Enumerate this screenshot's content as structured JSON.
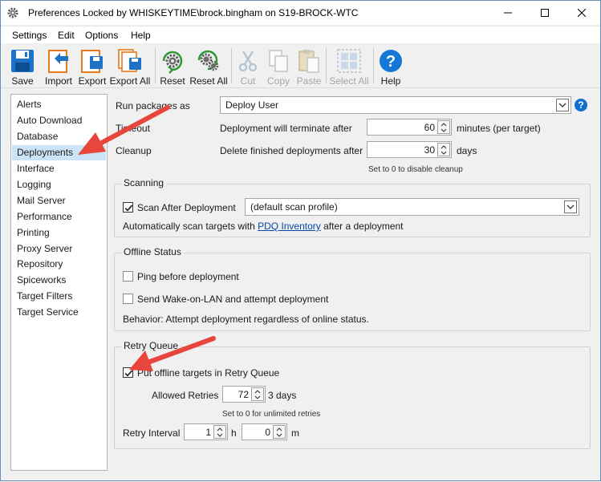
{
  "window": {
    "title": "Preferences Locked by WHISKEYTIME\\brock.bingham on S19-BROCK-WTC"
  },
  "menu": [
    "Settings",
    "Edit",
    "Options",
    "Help"
  ],
  "toolbar": {
    "save": "Save",
    "import": "Import",
    "export": "Export",
    "export_all": "Export All",
    "reset": "Reset",
    "reset_all": "Reset All",
    "cut": "Cut",
    "copy": "Copy",
    "paste": "Paste",
    "select_all": "Select All",
    "help": "Help"
  },
  "sidebar": {
    "selected": "Deployments",
    "items": [
      "Alerts",
      "Auto Download",
      "Database",
      "Deployments",
      "Interface",
      "Logging",
      "Mail Server",
      "Performance",
      "Printing",
      "Proxy Server",
      "Repository",
      "Spiceworks",
      "Target Filters",
      "Target Service"
    ]
  },
  "deployments": {
    "run_packages_label": "Run packages as",
    "run_packages_value": "Deploy User",
    "timeout_label": "Timeout",
    "timeout_desc": "Deployment will terminate after",
    "timeout_value": "60",
    "timeout_unit": "minutes (per target)",
    "cleanup_label": "Cleanup",
    "cleanup_desc": "Delete finished deployments after",
    "cleanup_value": "30",
    "cleanup_unit": "days",
    "cleanup_hint": "Set to 0 to disable cleanup"
  },
  "scanning": {
    "title": "Scanning",
    "scan_after_label": "Scan After Deployment",
    "scan_after_checked": true,
    "scan_profile": "(default scan profile)",
    "auto_text_before": "Automatically scan targets with ",
    "auto_link": "PDQ Inventory",
    "auto_text_after": " after a deployment"
  },
  "offline": {
    "title": "Offline Status",
    "ping_label": "Ping before deployment",
    "ping_checked": false,
    "wol_label": "Send Wake-on-LAN and attempt deployment",
    "wol_checked": false,
    "behavior": "Behavior: Attempt deployment regardless of online status."
  },
  "retry": {
    "title": "Retry Queue",
    "put_offline_label": "Put offline targets in Retry Queue",
    "put_offline_checked": true,
    "allowed_label": "Allowed Retries",
    "allowed_value": "72",
    "allowed_unit": "3 days",
    "hint": "Set to 0 for unlimited retries",
    "interval_label": "Retry Interval",
    "interval_hours": "1",
    "hours_unit": "h",
    "interval_minutes": "0",
    "minutes_unit": "m"
  },
  "colors": {
    "selection": "#cce4f7",
    "annotation_arrow": "#e8453c",
    "link": "#0645ad",
    "help_blue": "#0f6fd0"
  }
}
